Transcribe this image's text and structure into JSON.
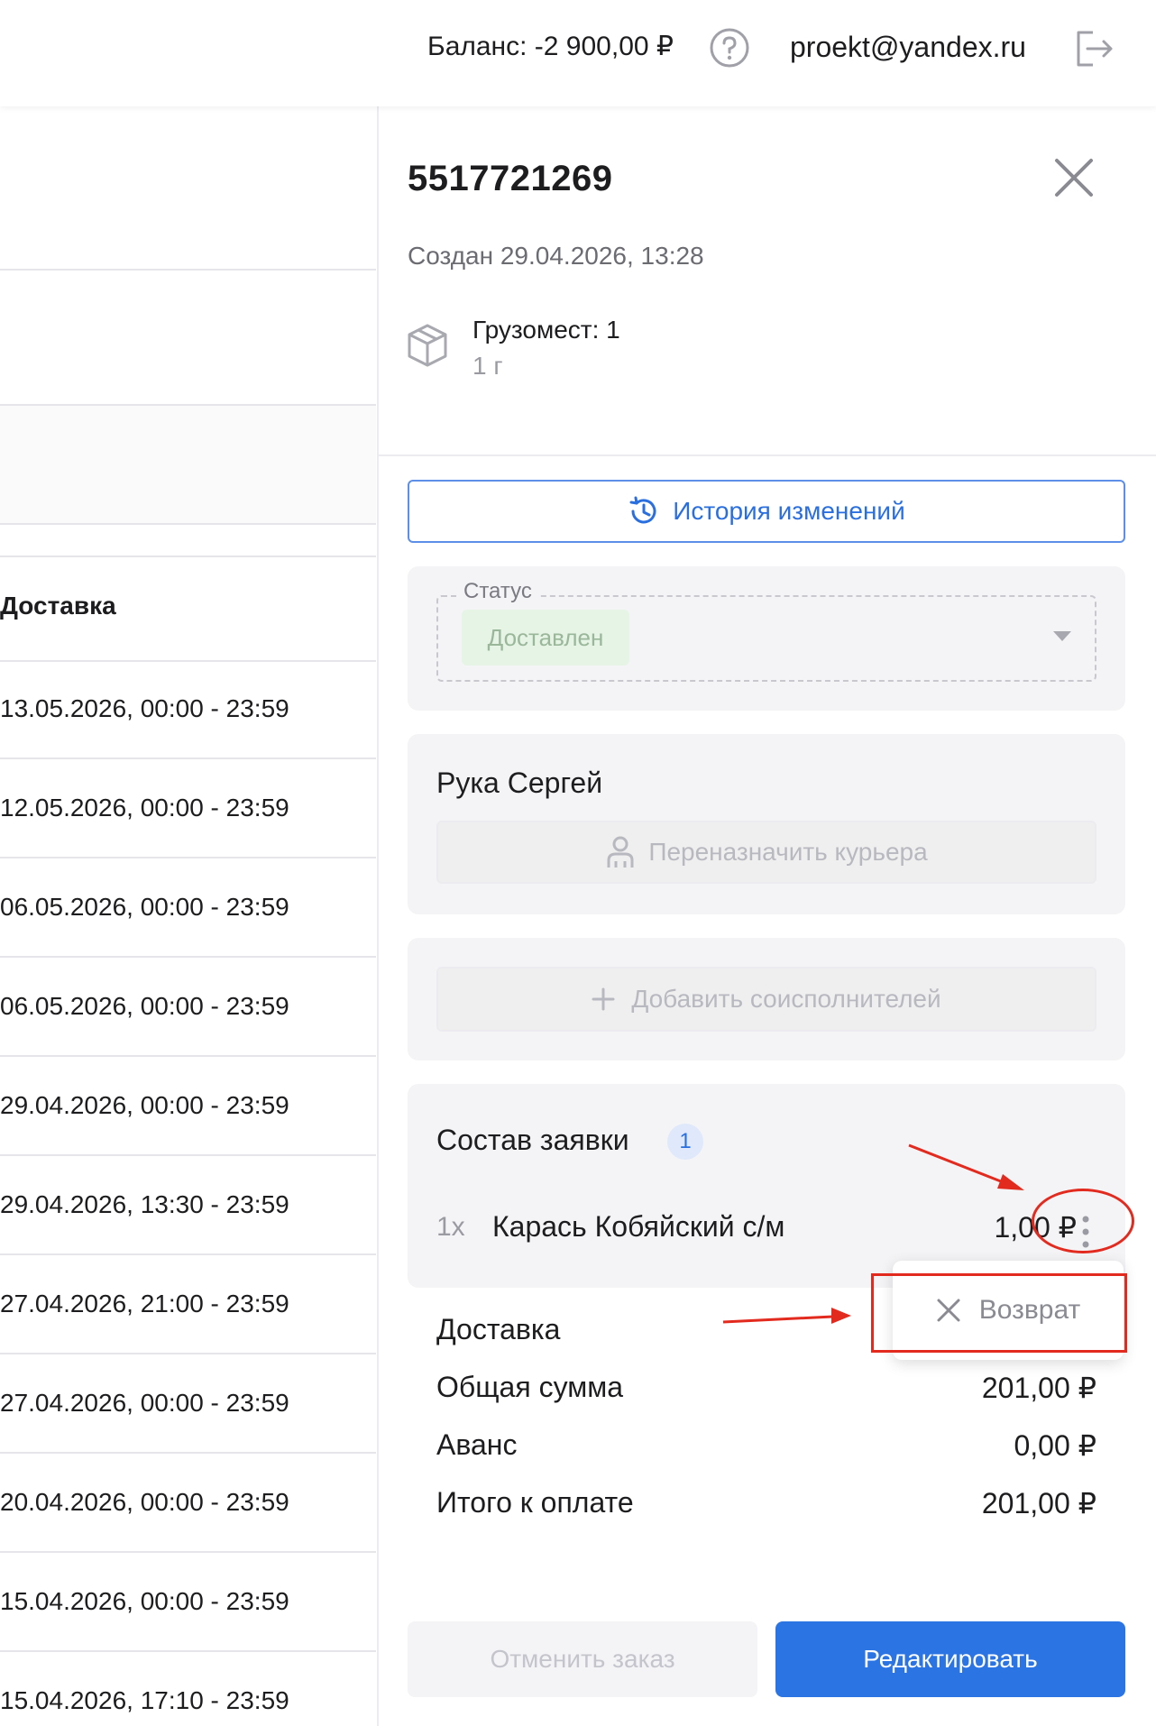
{
  "header": {
    "balance": "Баланс: -2 900,00 ₽",
    "email": "proekt@yandex.ru"
  },
  "table": {
    "column_header": "Доставка",
    "rows": [
      "13.05.2026, 00:00 - 23:59",
      "12.05.2026, 00:00 - 23:59",
      "06.05.2026, 00:00 - 23:59",
      "06.05.2026, 00:00 - 23:59",
      "29.04.2026, 00:00 - 23:59",
      "29.04.2026, 13:30 - 23:59",
      "27.04.2026, 21:00 - 23:59",
      "27.04.2026, 00:00 - 23:59",
      "20.04.2026, 00:00 - 23:59",
      "15.04.2026, 00:00 - 23:59",
      "15.04.2026, 17:10 - 23:59"
    ]
  },
  "order": {
    "number": "5517721269",
    "created": "Создан 29.04.2026, 13:28",
    "cargo": "Грузомест: 1",
    "weight": "1 г",
    "history_label": "История изменений",
    "status_legend": "Статус",
    "status_value": "Доставлен",
    "courier_name": "Рука Сергей",
    "reassign_label": "Переназначить курьера",
    "add_co_label": "Добавить соисполнителей",
    "composition_title": "Состав заявки",
    "composition_count": "1",
    "item": {
      "qty": "1x",
      "name": "Карась Кобяйский с/м",
      "price": "1,00 ₽"
    },
    "menu_return": "Возврат",
    "summary": {
      "delivery_label": "Доставка",
      "total_label": "Общая сумма",
      "total_value": "201,00 ₽",
      "advance_label": "Аванс",
      "advance_value": "0,00 ₽",
      "due_label": "Итого к оплате",
      "due_value": "201,00 ₽"
    },
    "cancel_label": "Отменить заказ",
    "edit_label": "Редактировать"
  },
  "colors": {
    "accent": "#2a74e4",
    "annotation": "#e32a1f",
    "status_chip": "#e6f4e6"
  }
}
